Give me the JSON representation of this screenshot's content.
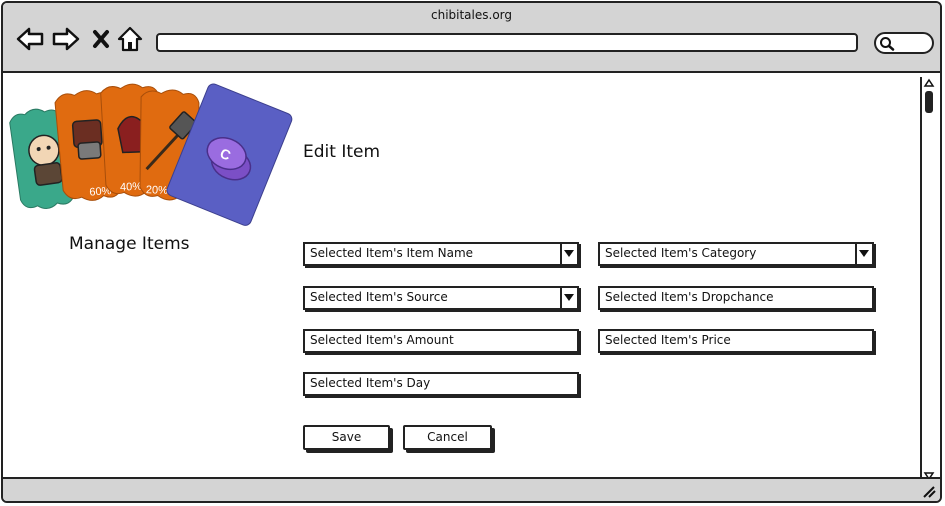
{
  "browser": {
    "site_title": "chibitales.org",
    "url": ""
  },
  "left_panel": {
    "cards_image": "item-cards-illustration",
    "card_badges": [
      "60%",
      "40%",
      "20%"
    ],
    "title": "Manage Items"
  },
  "form": {
    "title": "Edit Item",
    "item_name": "Selected Item's Item Name",
    "category": "Selected Item's Category",
    "source": "Selected Item's Source",
    "dropchance": "Selected Item's Dropchance",
    "amount": "Selected Item's Amount",
    "price": "Selected Item's Price",
    "day": "Selected Item's Day",
    "save_label": "Save",
    "cancel_label": "Cancel"
  },
  "colors": {
    "chrome": "#d4d4d4",
    "card_teal": "#3aa88a",
    "card_orange": "#e06b10",
    "card_purple": "#5a5fc4"
  }
}
